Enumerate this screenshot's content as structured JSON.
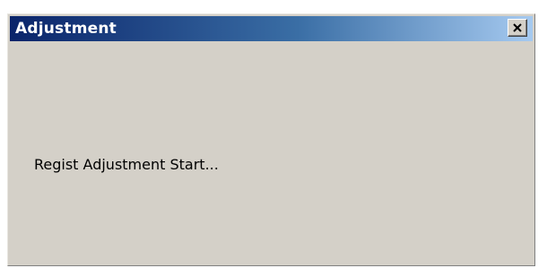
{
  "window": {
    "title": "Adjustment",
    "close_icon": "close-icon",
    "background_color": "#d4d0c8",
    "titlebar_color": "#0a246a"
  },
  "content": {
    "message": "Regist Adjustment Start..."
  }
}
